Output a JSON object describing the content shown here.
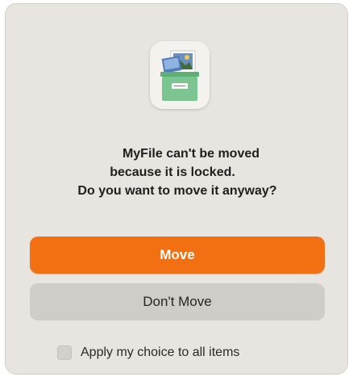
{
  "dialog": {
    "icon": "locked-file-icon",
    "message_line1": "MyFile can't be moved",
    "message_line2": "because it is locked.",
    "message_line3": "Do you want to move it anyway?",
    "primary_button": "Move",
    "secondary_button": "Don't Move",
    "checkbox_label": "Apply my choice to all items",
    "checkbox_checked": false
  },
  "colors": {
    "dialog_bg": "#e8e4e0",
    "primary": "#f26f12",
    "secondary": "#d0ccc8",
    "icon_green": "#7cc590"
  }
}
